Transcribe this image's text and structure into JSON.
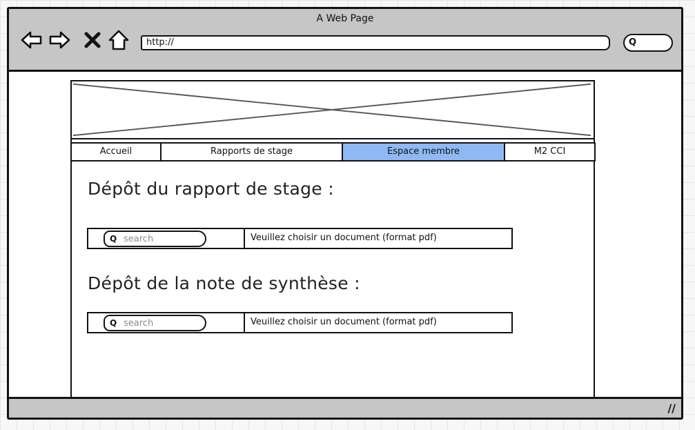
{
  "browser": {
    "title": "A Web Page",
    "url": "http://",
    "search_glyph": "Q",
    "icons": [
      "back-arrow-icon",
      "forward-arrow-icon",
      "close-icon",
      "home-icon",
      "search-icon"
    ]
  },
  "tabs": [
    {
      "label": "Accueil",
      "active": false
    },
    {
      "label": "Rapports de stage",
      "active": false
    },
    {
      "label": "Espace membre",
      "active": true
    },
    {
      "label": "M2 CCI",
      "active": false
    }
  ],
  "sections": [
    {
      "heading": "Dépôt du rapport de stage",
      "colon": ":",
      "search_placeholder": "search",
      "hint": "Veuillez choisir un document (format pdf)"
    },
    {
      "heading": "Dépôt de la note de synthèse",
      "colon": ":",
      "search_placeholder": "search",
      "hint": "Veuillez choisir un document (format pdf)"
    }
  ],
  "colors": {
    "active_tab": "#8fb9f5",
    "chrome": "#c6c6c6"
  }
}
